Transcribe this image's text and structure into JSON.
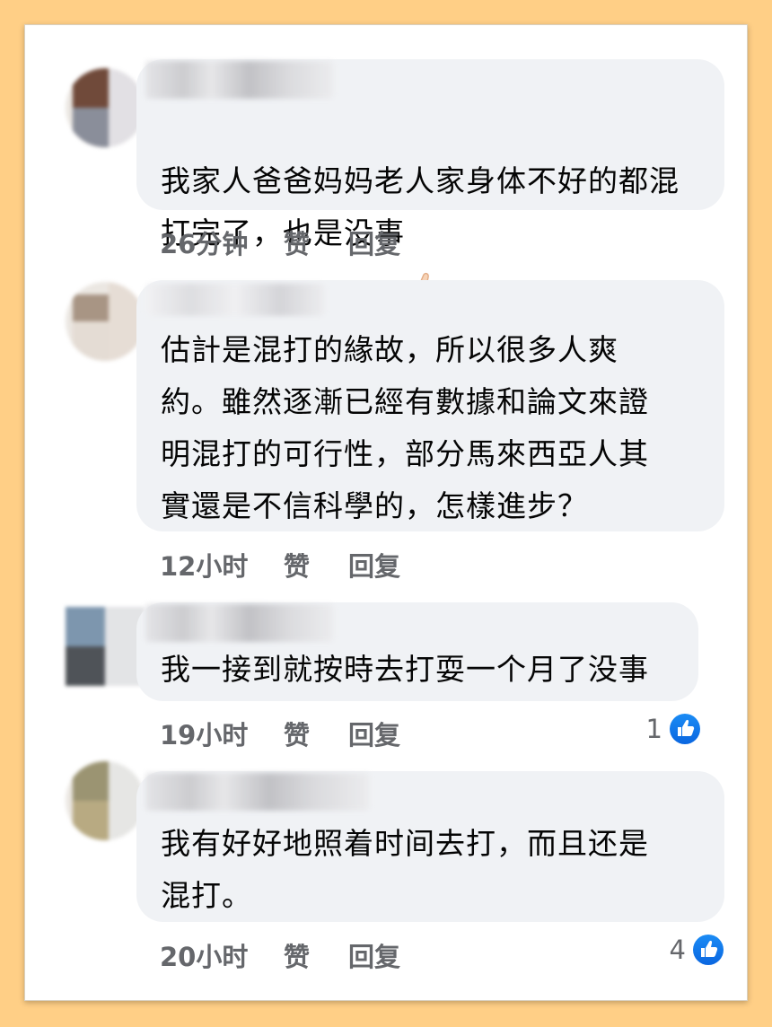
{
  "comments": [
    {
      "text": "我家人爸爸妈妈老人家身体不好的都混\n打完了，也是没事",
      "emoji_icon": "thumbs-up-emoji-icon",
      "time": "26分钟",
      "like_label": "赞",
      "reply_label": "回复",
      "avatar_colors": [
        "#704a3a",
        "#8a8e9a",
        "#8c8f9c"
      ]
    },
    {
      "text": "估計是混打的緣故，所以很多人爽\n約。雖然逐漸已經有數據和論文來證\n明混打的可行性，部分馬來西亞人其\n實還是不信科學的，怎樣進步？",
      "time": "12小时",
      "like_label": "赞",
      "reply_label": "回复",
      "avatar_colors": [
        "#a89584",
        "#e6ddd5",
        "#d9cfc6"
      ]
    },
    {
      "text": "我一接到就按時去打耍一个月了没事",
      "time": "19小时",
      "like_label": "赞",
      "reply_label": "回复",
      "reaction_count": "1",
      "reaction_icon": "like-reaction-icon",
      "avatar_colors": [
        "#7d96ae",
        "#4f5358",
        "#5c6066"
      ]
    },
    {
      "text": "我有好好地照着时间去打，而且还是\n混打。",
      "time": "20小时",
      "like_label": "赞",
      "reply_label": "回复",
      "reaction_count": "4",
      "reaction_icon": "like-reaction-icon",
      "avatar_colors": [
        "#9b9472",
        "#b8aa82",
        "#a39b7c"
      ]
    }
  ],
  "colors": {
    "background": "#ffcf86",
    "bubble": "#f0f2f5",
    "meta_text": "#65676b",
    "like_blue": "#1877f2"
  }
}
